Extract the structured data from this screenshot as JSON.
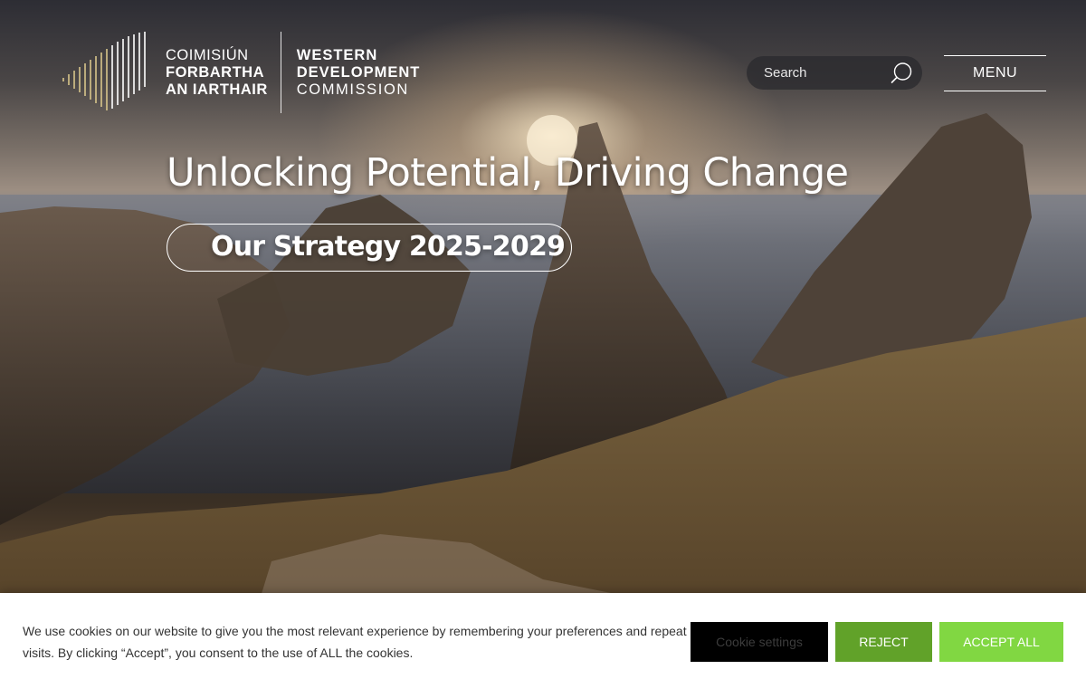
{
  "logo": {
    "irish": [
      "COIMISIÚN",
      "FORBARTHA",
      "AN IARTHAIR"
    ],
    "english": [
      "WESTERN",
      "DEVELOPMENT",
      "COMMISSION"
    ]
  },
  "header": {
    "search_placeholder": "Search",
    "menu_label": "MENU"
  },
  "hero": {
    "title": "Unlocking Potential, Driving Change",
    "cta_label": "Our Strategy 2025-2029"
  },
  "cookie_banner": {
    "text": "We use cookies on our website to give you the most relevant experience by remembering your preferences and repeat visits. By clicking “Accept”, you consent to the use of ALL the cookies.",
    "settings_label": "Cookie settings",
    "reject_label": "REJECT",
    "accept_label": "ACCEPT ALL"
  },
  "colors": {
    "reject": "#61a229",
    "accept": "#81d742",
    "settings": "#000000",
    "logo_accent": "#d8c58a"
  },
  "icons": [
    "search-icon",
    "logo-mark-icon"
  ]
}
